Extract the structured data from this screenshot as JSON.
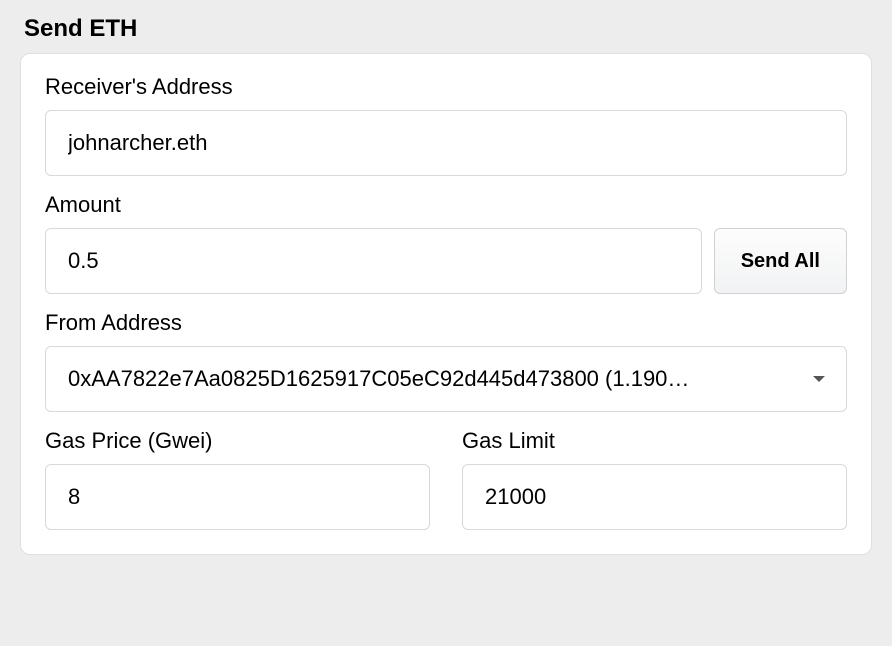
{
  "title": "Send ETH",
  "receiver": {
    "label": "Receiver's Address",
    "value": "johnarcher.eth"
  },
  "amount": {
    "label": "Amount",
    "value": "0.5",
    "send_all_label": "Send All"
  },
  "from": {
    "label": "From Address",
    "selected": "0xAA7822e7Aa0825D1625917C05eC92d445d473800 (1.190…"
  },
  "gas_price": {
    "label": "Gas Price (Gwei)",
    "value": "8"
  },
  "gas_limit": {
    "label": "Gas Limit",
    "value": "21000"
  }
}
